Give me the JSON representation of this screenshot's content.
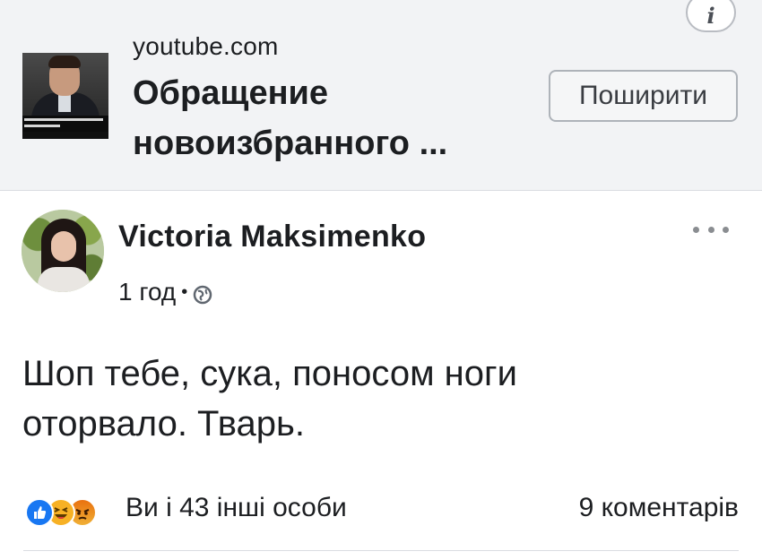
{
  "link_preview": {
    "domain": "youtube.com",
    "title_lines": [
      "Обращение",
      "новоизбранного ..."
    ],
    "share_label": "Поширити",
    "info_icon": "info-icon",
    "thumbnail_caption_lines": [
      "ИЯ НОВООБРАННОГО ПРЕЗИДЕНТА",
      "ИРА ЗЕЛЕНСЬКОГО"
    ]
  },
  "comment": {
    "author": "Victoria Maksimenko",
    "time": "1 год",
    "separator": "•",
    "privacy_icon": "globe-icon",
    "text_lines": [
      "Шоп тебе, сука, поносом ноги",
      "оторвало. Тварь."
    ],
    "more_icon": "more-dots-icon"
  },
  "reactions_bar": {
    "reaction_icons": [
      "like-icon",
      "haha-icon",
      "angry-icon"
    ],
    "summary": "Ви і 43 інші особи",
    "comments": "9 коментарів"
  },
  "colors": {
    "card_background": "#f2f3f5",
    "like_blue": "#1877f2",
    "haha_yellow": "#f7b125",
    "angry_orange": "#e9710f",
    "text": "#1c1e21"
  }
}
